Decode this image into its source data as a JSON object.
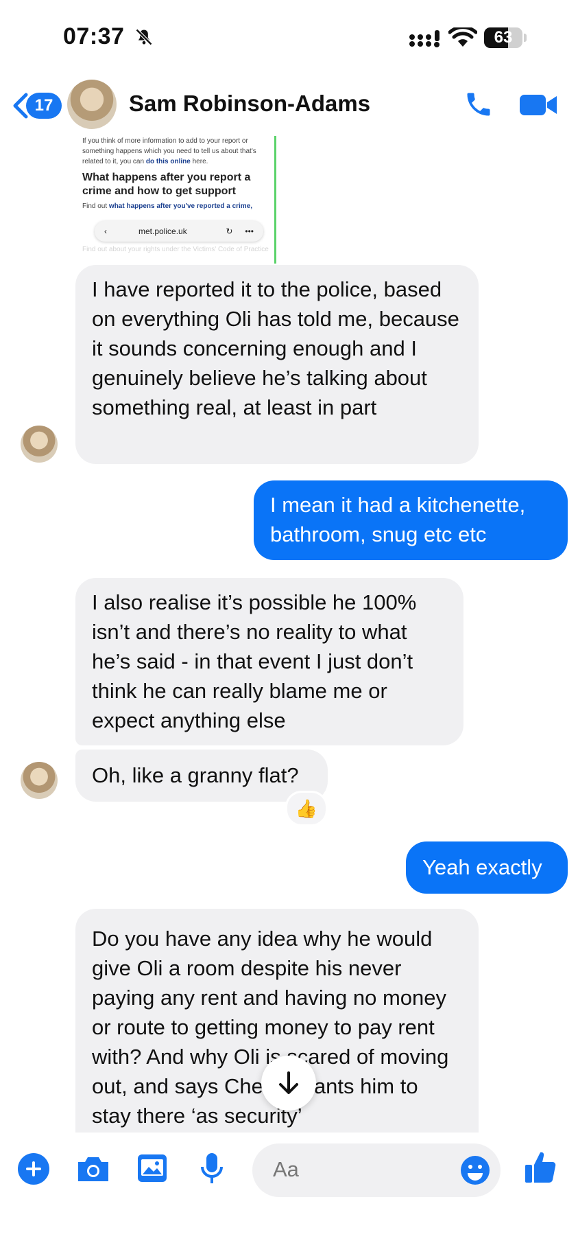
{
  "status_bar": {
    "time": "07:37",
    "battery": "63"
  },
  "header": {
    "unread_count": "17",
    "contact_name": "Sam Robinson-Adams"
  },
  "link_preview": {
    "intro": "If you think of more information to add to your report or something happens which you need to tell us about that's related to it, you can",
    "intro_link": "do this online",
    "intro_end": "here.",
    "heading": "What happens after you report a crime and how to get support",
    "find_prefix": "Find out",
    "find_link": "what happens after you've reported a crime,",
    "url": "met.police.uk",
    "faded": "Find out about your rights under the Victims' Code of Practice"
  },
  "messages": [
    {
      "direction": "received",
      "text": "I have reported it to the police, based on everything Oli has told me, because it sounds concerning enough and I genuinely believe he’s talking about something real, at least in part"
    },
    {
      "direction": "sent",
      "text": "I mean it had a kitchenette, bathroom, snug etc etc"
    },
    {
      "direction": "received",
      "text": "I also realise it’s possible he 100% isn’t and there’s no reality to what he’s said - in that event I just don’t think he can really blame me or expect anything else"
    },
    {
      "direction": "received",
      "text": "Oh, like a granny flat?",
      "reaction": "👍"
    },
    {
      "direction": "sent",
      "text": "Yeah exactly"
    },
    {
      "direction": "received",
      "text": "Do you have any idea why he would give Oli a room despite his never paying any rent and having no money or route to getting money to pay rent with? And why Oli is scared of moving out, and says Cherny wants him to stay there ‘as security’"
    }
  ],
  "composer": {
    "placeholder": "Aa"
  },
  "colors": {
    "accent": "#0a74f7",
    "received_bubble": "#f0f0f2"
  }
}
